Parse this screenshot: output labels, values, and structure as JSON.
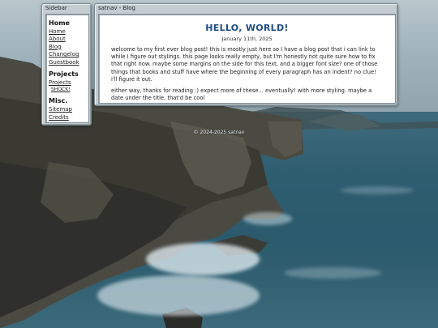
{
  "sidebar": {
    "window_title": "Sidebar",
    "sections": [
      {
        "heading": "Home",
        "links": [
          "Home",
          "About",
          "Blog",
          "Changelog",
          "Guestbook"
        ]
      },
      {
        "heading": "Projects",
        "links": [
          "Projects"
        ],
        "sublinks": [
          "SHOCK!"
        ]
      },
      {
        "heading": "Misc.",
        "links": [
          "Sitemap",
          "Credits"
        ]
      }
    ]
  },
  "main": {
    "window_title": "satnav - Blog",
    "post": {
      "title": "HELLO, WORLD!",
      "date": "January 11th, 2025",
      "paragraphs": [
        "welcome to my first ever blog post! this is mostly just here so I have a blog post that i can link to while I figure out stylings. this page looks really empty, but I'm honestly not quite sure how to fix that right now. maybe some margins on the side for this text, and a bigger font size? one of those things that books and stuff have where the beginning of every paragraph has an indent? no clue! i'll figure it out.",
        "either way, thanks for reading :) expect more of these... eventually! with more styling. maybe a date under the title. that'd be cool"
      ]
    }
  },
  "footer": {
    "text": "© 2024-2025 satnav"
  }
}
